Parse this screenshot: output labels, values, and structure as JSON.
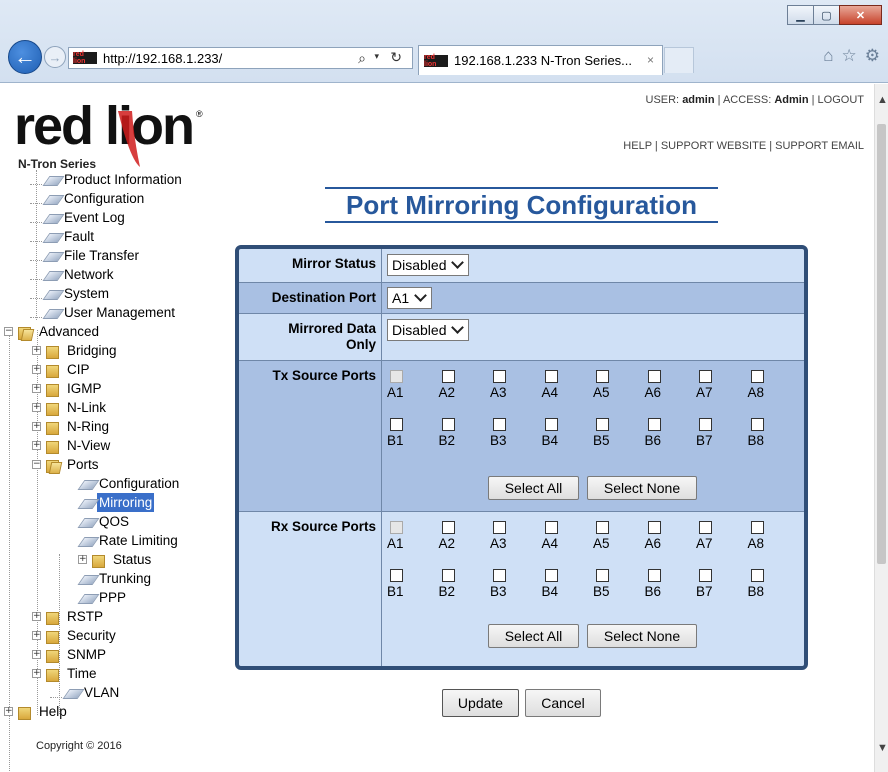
{
  "browser": {
    "url": "http://192.168.1.233/",
    "tab_title": "192.168.1.233 N-Tron Series...",
    "tab_close": "×",
    "favicon_text": "red lion",
    "icons": [
      "back-arrow-icon",
      "forward-arrow-icon",
      "search-icon",
      "refresh-icon",
      "home-icon",
      "star-icon",
      "gear-icon",
      "minimize-icon",
      "maximize-icon",
      "close-icon"
    ]
  },
  "header": {
    "logo_text": "red lion",
    "logo_sub": "N-Tron Series",
    "user_label": "USER:",
    "user": "admin",
    "access_label": "ACCESS:",
    "access": "Admin",
    "logout": "LOGOUT",
    "help": "HELP",
    "support_website": "SUPPORT WEBSITE",
    "support_email": "SUPPORT EMAIL",
    "sep": "|"
  },
  "tree": {
    "product_information": "Product Information",
    "configuration": "Configuration",
    "event_log": "Event Log",
    "fault": "Fault",
    "file_transfer": "File Transfer",
    "network": "Network",
    "system": "System",
    "user_management": "User Management",
    "advanced": "Advanced",
    "bridging": "Bridging",
    "cip": "CIP",
    "igmp": "IGMP",
    "nlink": "N-Link",
    "nring": "N-Ring",
    "nview": "N-View",
    "ports": "Ports",
    "ports_configuration": "Configuration",
    "mirroring": "Mirroring",
    "qos": "QOS",
    "rate_limiting": "Rate Limiting",
    "status": "Status",
    "trunking": "Trunking",
    "ppp": "PPP",
    "rstp": "RSTP",
    "security": "Security",
    "snmp": "SNMP",
    "time": "Time",
    "vlan": "VLAN",
    "help": "Help",
    "plus": "+",
    "minus": "−",
    "selected": "Mirroring"
  },
  "copyright": "Copyright © 2016",
  "main": {
    "title": "Port Mirroring Configuration",
    "mirror_status_label": "Mirror Status",
    "mirror_status_value": "Disabled",
    "destination_port_label": "Destination Port",
    "destination_port_value": "A1",
    "mirrored_data_only_label": "Mirrored Data Only",
    "mirrored_data_only_value": "Disabled",
    "tx_label": "Tx Source Ports",
    "rx_label": "Rx Source Ports",
    "ports_row_a": [
      "A1",
      "A2",
      "A3",
      "A4",
      "A5",
      "A6",
      "A7",
      "A8"
    ],
    "ports_row_b": [
      "B1",
      "B2",
      "B3",
      "B4",
      "B5",
      "B6",
      "B7",
      "B8"
    ],
    "disabled_port": "A1",
    "select_all": "Select All",
    "select_none": "Select None",
    "update": "Update",
    "cancel": "Cancel"
  }
}
